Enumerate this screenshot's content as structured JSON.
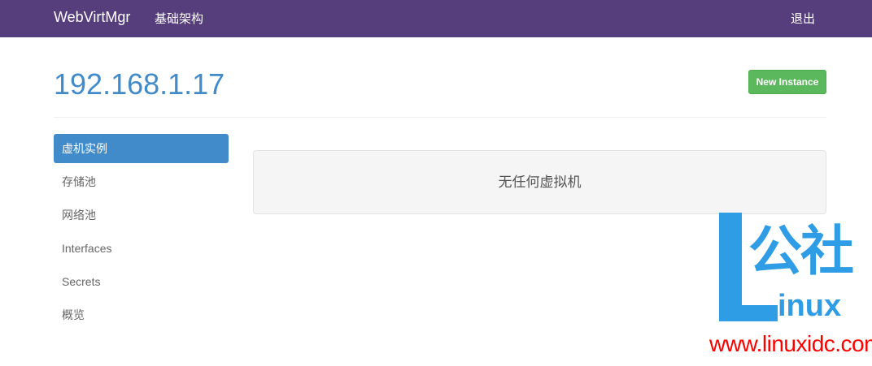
{
  "navbar": {
    "brand": "WebVirtMgr",
    "infrastructure_link": "基础架构",
    "logout_link": "退出",
    "background_color": "#563d7c"
  },
  "page": {
    "title": "192.168.1.17",
    "new_instance_button": "New Instance"
  },
  "sidebar": {
    "items": [
      {
        "label": "虚机实例",
        "active": true
      },
      {
        "label": "存储池",
        "active": false
      },
      {
        "label": "网络池",
        "active": false
      },
      {
        "label": "Interfaces",
        "active": false
      },
      {
        "label": "Secrets",
        "active": false
      },
      {
        "label": "概览",
        "active": false
      }
    ]
  },
  "main": {
    "empty_message": "无任何虚拟机"
  },
  "watermark": {
    "logo_chars": "公社",
    "logo_suffix": "inux",
    "url": "www.linuxidc.com",
    "logo_color": "#2e9de6",
    "url_color": "#ff0000"
  },
  "colors": {
    "title": "#428bca",
    "active_nav": "#428bca",
    "new_button": "#5cb85c"
  }
}
